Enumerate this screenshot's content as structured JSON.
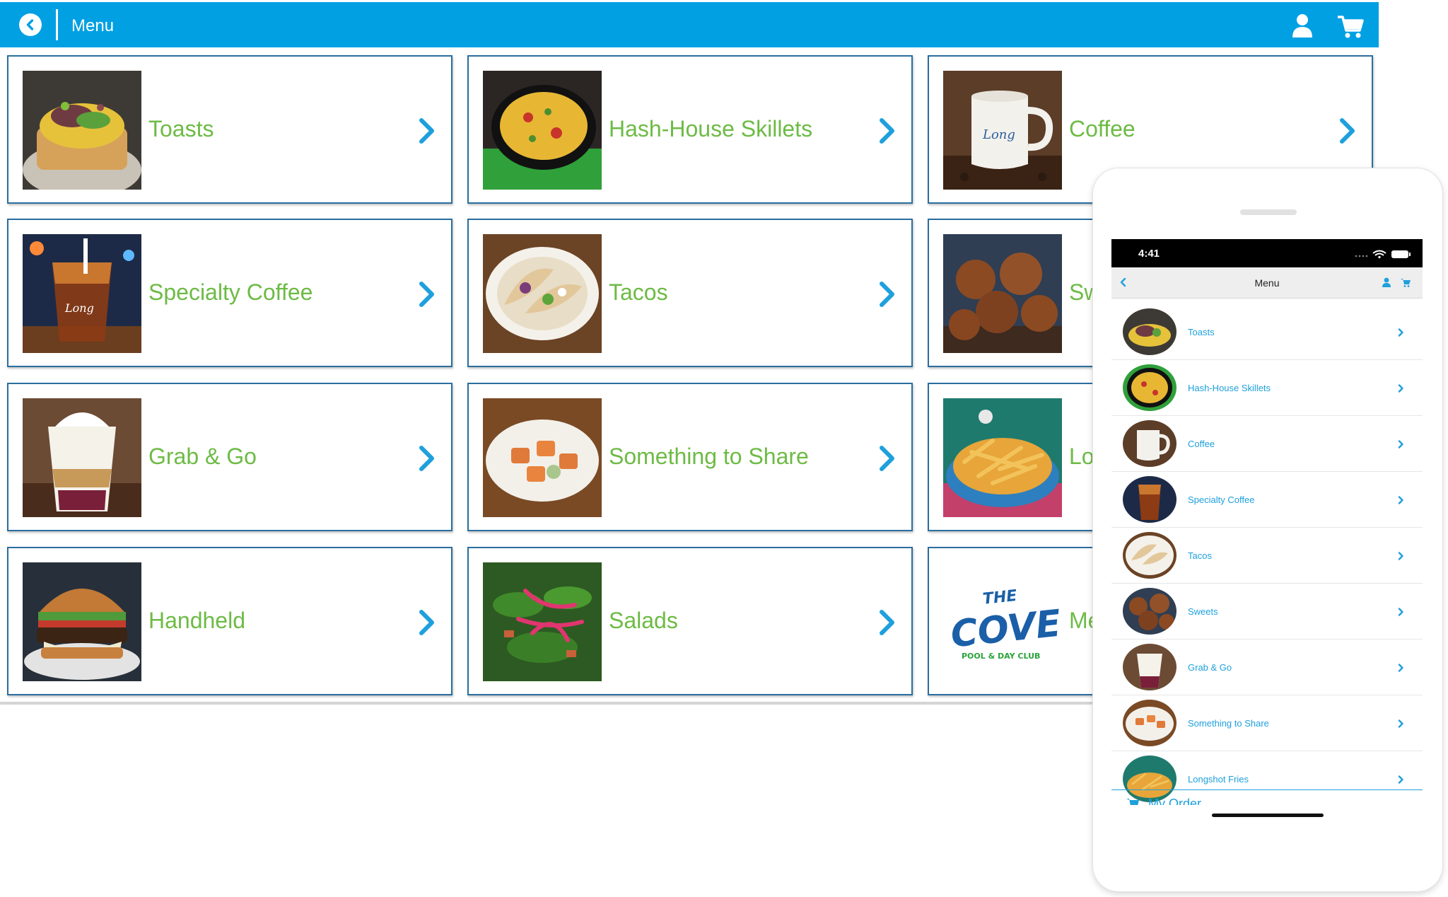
{
  "header": {
    "title": "Menu",
    "back_icon": "back-arrow-circle-icon",
    "user_icon": "user-icon",
    "cart_icon": "cart-icon"
  },
  "colors": {
    "accent": "#00a0e3",
    "label_green": "#6dbb45",
    "card_border": "#2b6e9e",
    "phone_link": "#1ea0dc"
  },
  "menu_cards": [
    {
      "label": "Toasts",
      "image": "toast-photo"
    },
    {
      "label": "Hash-House Skillets",
      "image": "skillet-photo"
    },
    {
      "label": "Coffee",
      "image": "coffee-mug-photo"
    },
    {
      "label": "Specialty Coffee",
      "image": "iced-coffee-photo"
    },
    {
      "label": "Tacos",
      "image": "tacos-photo"
    },
    {
      "label": "Sw",
      "image": "donut-holes-photo"
    },
    {
      "label": "Grab & Go",
      "image": "parfait-photo"
    },
    {
      "label": "Something to Share",
      "image": "share-plate-photo"
    },
    {
      "label": "Lo",
      "image": "fries-photo"
    },
    {
      "label": "Handheld",
      "image": "burger-photo"
    },
    {
      "label": "Salads",
      "image": "salad-photo"
    },
    {
      "label": "Me",
      "image": "cove-logo"
    }
  ],
  "cove_logo": {
    "main": "THE COVE",
    "sub": "POOL & DAY CLUB"
  },
  "phone": {
    "time": "4:41",
    "nav_title": "Menu",
    "items": [
      {
        "label": "Toasts"
      },
      {
        "label": "Hash-House Skillets"
      },
      {
        "label": "Coffee"
      },
      {
        "label": "Specialty Coffee"
      },
      {
        "label": "Tacos"
      },
      {
        "label": "Sweets"
      },
      {
        "label": "Grab & Go"
      },
      {
        "label": "Something to Share"
      },
      {
        "label": "Longshot Fries"
      }
    ],
    "my_order_label": "My Order"
  }
}
